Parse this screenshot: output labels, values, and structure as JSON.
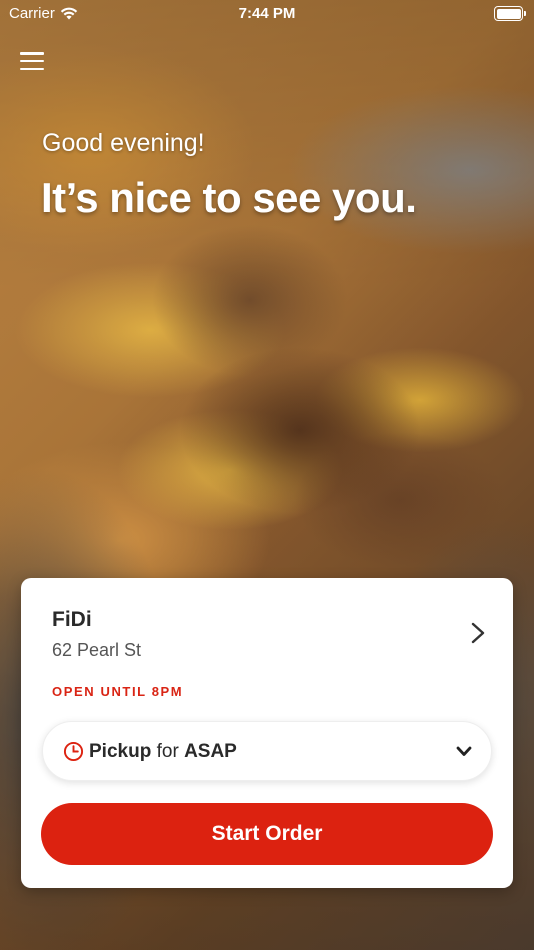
{
  "status_bar": {
    "carrier": "Carrier",
    "time": "7:44 PM"
  },
  "greeting": {
    "small": "Good evening!",
    "headline": "It’s nice to see you."
  },
  "location": {
    "name": "FiDi",
    "address": "62 Pearl St",
    "status": "OPEN UNTIL 8PM"
  },
  "pickup": {
    "mode": "Pickup",
    "connector": "for",
    "time": "ASAP"
  },
  "actions": {
    "start_order": "Start Order"
  },
  "icons": {
    "menu": "hamburger-menu-icon",
    "wifi": "wifi-icon",
    "battery": "battery-icon",
    "chevron_right": "chevron-right-icon",
    "clock": "clock-icon",
    "chevron_down": "chevron-down-icon"
  },
  "colors": {
    "brand_red": "#dc2210",
    "text_dark": "#2a2a2a",
    "text_gray": "#555555",
    "card_bg": "#ffffff"
  }
}
